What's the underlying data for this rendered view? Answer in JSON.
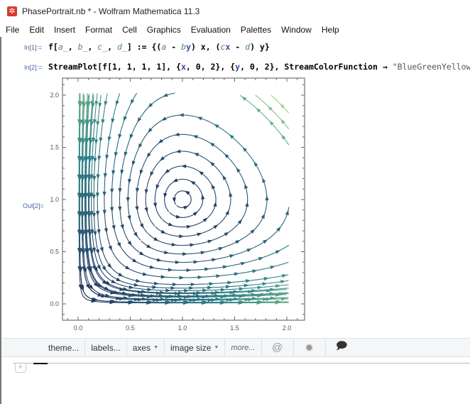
{
  "window": {
    "title": "PhasePortrait.nb * - Wolfram Mathematica 11.3",
    "icon": "mathematica-icon"
  },
  "menu": [
    "File",
    "Edit",
    "Insert",
    "Format",
    "Cell",
    "Graphics",
    "Evaluation",
    "Palettes",
    "Window",
    "Help"
  ],
  "cells": {
    "in1_label": "In[1]:=",
    "in2_label": "In[2]:=",
    "out2_label": "Out[2]=",
    "in1_code": {
      "head": "f[",
      "a": "a_",
      "comma": ", ",
      "b": "b_",
      "c": "c_",
      "d": "d_",
      "rest": "] := {(",
      "a2": "a",
      "m1": " - ",
      "b2": "b",
      "y1": "y",
      "y1_rest": ") x, (",
      "c2": "c",
      "x2": "x",
      "m2": " - ",
      "d2": "d",
      "end": ") y}"
    },
    "in2_code": {
      "part1": "StreamPlot[f[1, 1, 1, 1], {",
      "x": "x",
      "sep1": ", 0, 2}, {",
      "y": "y",
      "sep2": ", 0, 2}, StreamColorFunction → ",
      "str": "\"BlueGreenYellow\"",
      "end": "]"
    }
  },
  "plot": {
    "xticks": [
      "0.0",
      "0.5",
      "1.0",
      "1.5",
      "2.0"
    ],
    "yticks": [
      "0.0",
      "0.5",
      "1.0",
      "1.5",
      "2.0"
    ],
    "xrange": [
      0,
      2
    ],
    "yrange": [
      0,
      2
    ],
    "color_function": "BlueGreenYellow",
    "colors": {
      "slow": "#24305e",
      "mid": "#2c7f86",
      "fast": "#9fd98a"
    }
  },
  "toolbar": {
    "theme": "theme...",
    "labels": "labels...",
    "axes": "axes",
    "image_size": "image size",
    "more": "more...",
    "icons": [
      "spiral-icon",
      "gear-icon",
      "comment-icon"
    ]
  }
}
